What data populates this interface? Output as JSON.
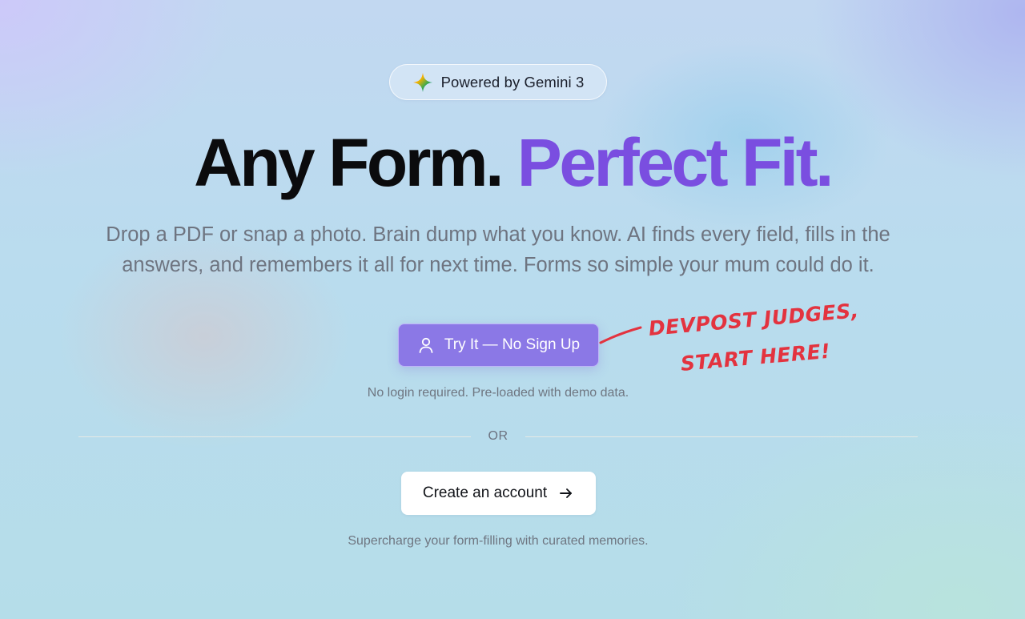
{
  "badge": {
    "label": "Powered by Gemini 3",
    "icon": "gemini-sparkle-icon"
  },
  "hero": {
    "headline_dark": "Any Form.",
    "headline_accent": "Perfect Fit.",
    "subtitle": "Drop a PDF or snap a photo. Brain dump what you know. AI finds every field, fills in the answers, and remembers it all for next time. Forms so simple your mum could do it."
  },
  "primary_cta": {
    "label": "Try It — No Sign Up",
    "icon": "user-icon",
    "note": "No login required. Pre-loaded with demo data."
  },
  "annotation": {
    "line1": "DEVPOST JUDGES,",
    "line2": "START HERE!"
  },
  "divider": {
    "label": "OR"
  },
  "secondary_cta": {
    "label": "Create an account",
    "icon": "arrow-right-icon",
    "note": "Supercharge your form-filling with curated memories."
  },
  "colors": {
    "accent": "#7a4ee0",
    "primary_button": "#8b78e6",
    "annotation": "#e3333f",
    "headline": "#0b0b0d",
    "muted_text": "#6e7480"
  }
}
